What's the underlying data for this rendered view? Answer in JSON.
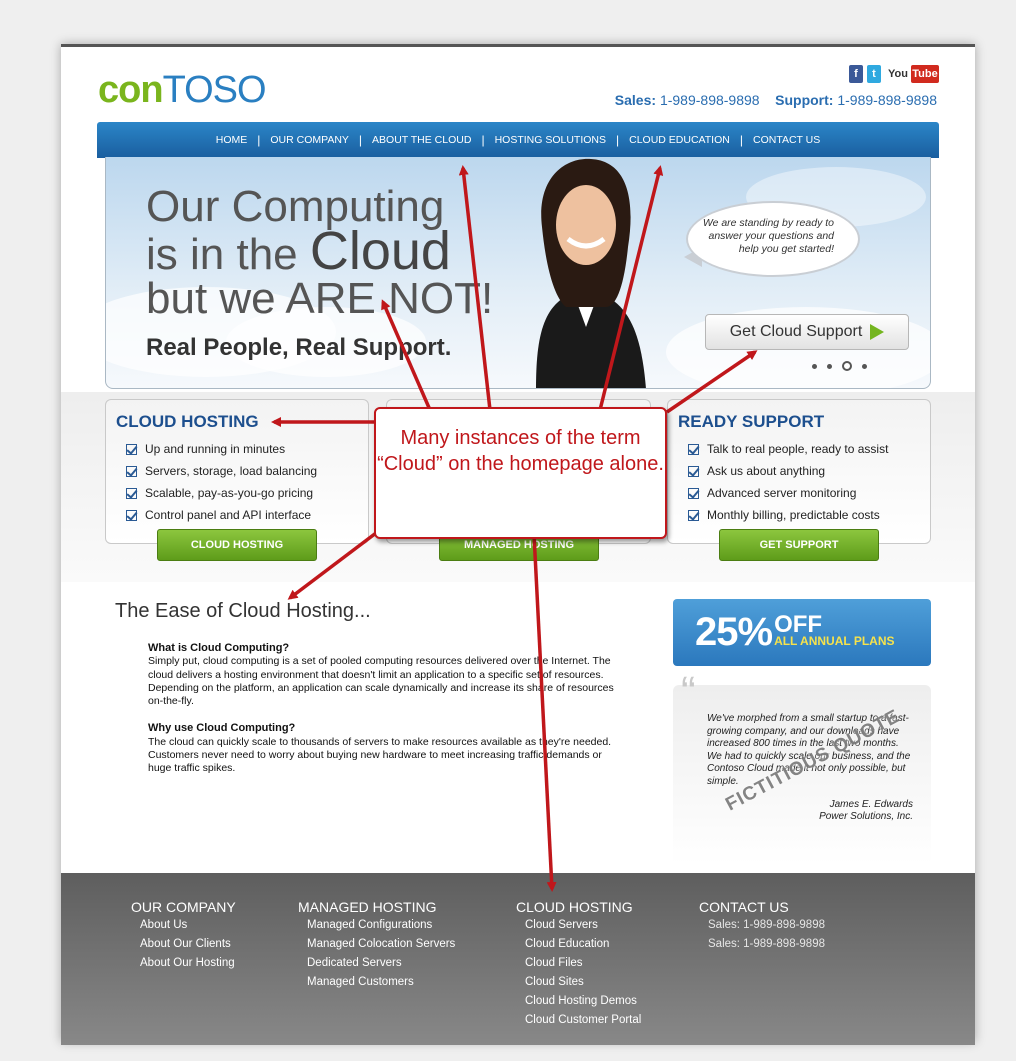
{
  "logo": {
    "part1": "con",
    "part2": "TOSO"
  },
  "social": {
    "facebook": "f",
    "twitter": "t",
    "youtube_you": "You",
    "youtube_tube": "Tube"
  },
  "header": {
    "sales_label": "Sales:",
    "sales_number": "1-989-898-9898",
    "support_label": "Support:",
    "support_number": "1-989-898-9898"
  },
  "nav": [
    "HOME",
    "OUR COMPANY",
    "ABOUT THE CLOUD",
    "HOSTING SOLUTIONS",
    "CLOUD EDUCATION",
    "CONTACT US"
  ],
  "hero": {
    "line1": "Our Computing",
    "line2a": "is in the ",
    "line2b": "Cloud",
    "line3": "but we ARE NOT!",
    "subline": "Real People, Real Support.",
    "bubble": "We are standing by ready to answer your questions and help you get started!",
    "cta": "Get Cloud Support"
  },
  "features": [
    {
      "title": "CLOUD HOSTING",
      "items": [
        "Up and running in minutes",
        "Servers, storage, load balancing",
        "Scalable, pay-as-you-go pricing",
        "Control panel and API interface"
      ],
      "button": "CLOUD HOSTING"
    },
    {
      "title": "",
      "items": [],
      "button": "MANAGED HOSTING"
    },
    {
      "title": "READY SUPPORT",
      "items": [
        "Talk to real people, ready to assist",
        "Ask us about anything",
        "Advanced server monitoring",
        "Monthly billing, predictable costs"
      ],
      "button": "GET SUPPORT"
    }
  ],
  "ease": {
    "title": "The Ease of Cloud Hosting...",
    "q1": "What is Cloud Computing?",
    "a1": "Simply put, cloud computing is a set of pooled computing resources delivered over the Internet. The cloud delivers a hosting environment that doesn't limit an application to a specific set of resources. Depending on the platform, an application can scale dynamically and increase its share of resources on-the-fly.",
    "q2": "Why use Cloud Computing?",
    "a2": "The cloud can quickly scale to thousands of servers to make resources available as they're needed. Customers never need to worry about buying new hardware to meet increasing traffic demands or huge traffic spikes."
  },
  "promo": {
    "percent": "25%",
    "off": "OFF",
    "plans": "ALL ANNUAL PLANS"
  },
  "testimonial": {
    "text": "We've morphed from a small startup to a fast-growing company, and our downloads have increased 800 times in the last two months. We had to quickly scale our business, and the Contoso Cloud made it not only possible, but simple.",
    "author": "James E. Edwards",
    "company": "Power Solutions, Inc.",
    "stamp": "FICTITIOUS QUOTE"
  },
  "footer": [
    {
      "title": "OUR COMPANY",
      "links": [
        "About Us",
        "About Our Clients",
        "About Our Hosting"
      ]
    },
    {
      "title": "MANAGED HOSTING",
      "links": [
        "Managed Configurations",
        "Managed Colocation Servers",
        "Dedicated Servers",
        "Managed Customers"
      ]
    },
    {
      "title": "CLOUD HOSTING",
      "links": [
        "Cloud Servers",
        "Cloud Education",
        "Cloud Files",
        "Cloud Sites",
        "Cloud Hosting Demos",
        "Cloud Customer Portal"
      ]
    },
    {
      "title": "CONTACT US",
      "links": [
        "Sales: 1-989-898-9898",
        "Sales: 1-989-898-9898"
      ]
    }
  ],
  "annotation": {
    "text": "Many instances of the term “Cloud” on the homepage alone.",
    "color": "#c0171b"
  }
}
